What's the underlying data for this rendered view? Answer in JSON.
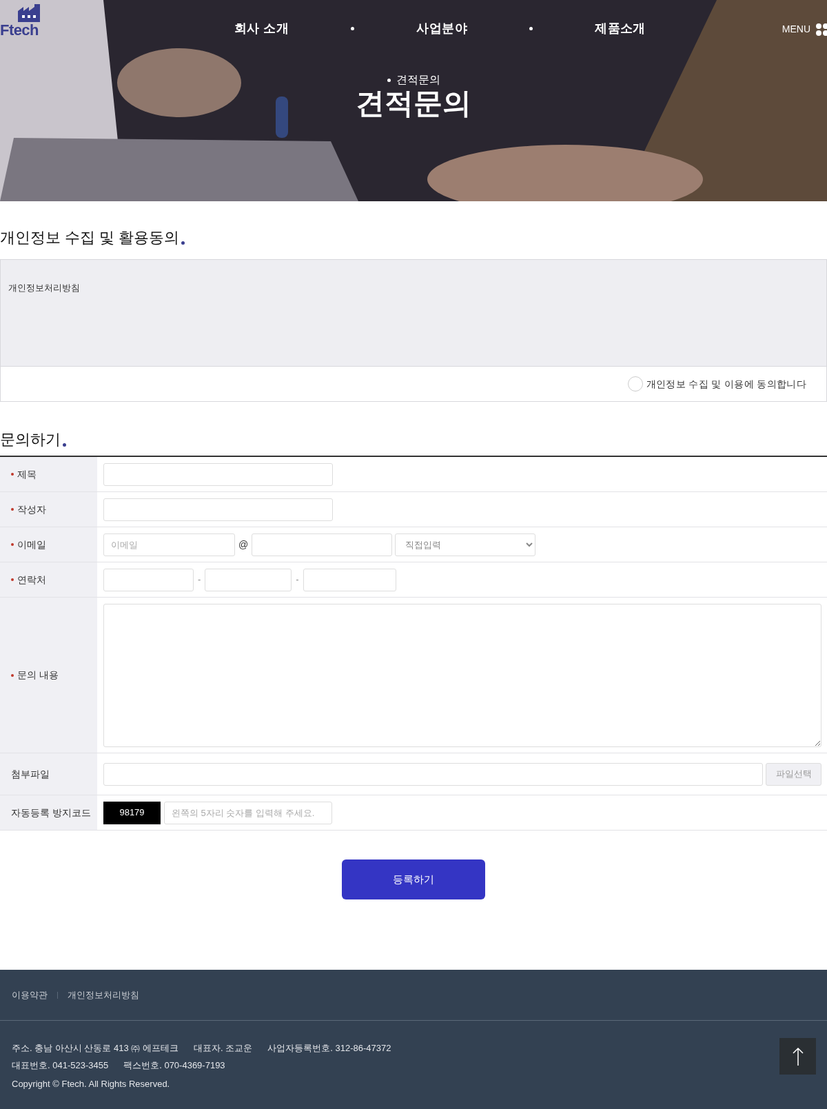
{
  "header": {
    "logo": "Ftech",
    "nav": [
      "회사 소개",
      "사업분야",
      "제품소개"
    ],
    "menu_label": "MENU"
  },
  "hero": {
    "breadcrumb": "견적문의",
    "title": "견적문의"
  },
  "privacy": {
    "title": "개인정보 수집 및 활용동의",
    "policy_text": "개인정보처리방침",
    "agree_label": "개인정보 수집 및 이용에 동의합니다",
    "agreed": false
  },
  "inquiry": {
    "title": "문의하기",
    "rows": [
      {
        "kind": "text",
        "label": "제목",
        "required": true
      },
      {
        "kind": "text",
        "label": "작성자",
        "required": true
      },
      {
        "kind": "email",
        "label": "이메일",
        "required": true,
        "placeholder": "이메일",
        "separator": "@",
        "select_value": "직접입력"
      },
      {
        "kind": "phone",
        "label": "연락처",
        "required": true,
        "separator": "-"
      },
      {
        "kind": "textarea",
        "label": "문의 내용",
        "required": true
      },
      {
        "kind": "file",
        "label": "첨부파일",
        "required": false,
        "button": "파일선택"
      },
      {
        "kind": "captcha",
        "label": "자동등록 방지코드",
        "required": false,
        "code": "98179",
        "placeholder": "왼쪽의 5자리 숫자를 입력해 주세요."
      }
    ],
    "submit": "등록하기"
  },
  "footer": {
    "links": [
      "이용약관",
      "개인정보처리방침"
    ],
    "info_lines": [
      [
        "주소. 충남 아산시 산동로 413 ㈜ 에프테크",
        "대표자. 조교운",
        "사업자등록번호. 312-86-47372"
      ],
      [
        "대표번호. 041-523-3455",
        "팩스번호. 070-4369-7193"
      ]
    ],
    "copyright": "Copyright © Ftech. All Rights Reserved."
  }
}
